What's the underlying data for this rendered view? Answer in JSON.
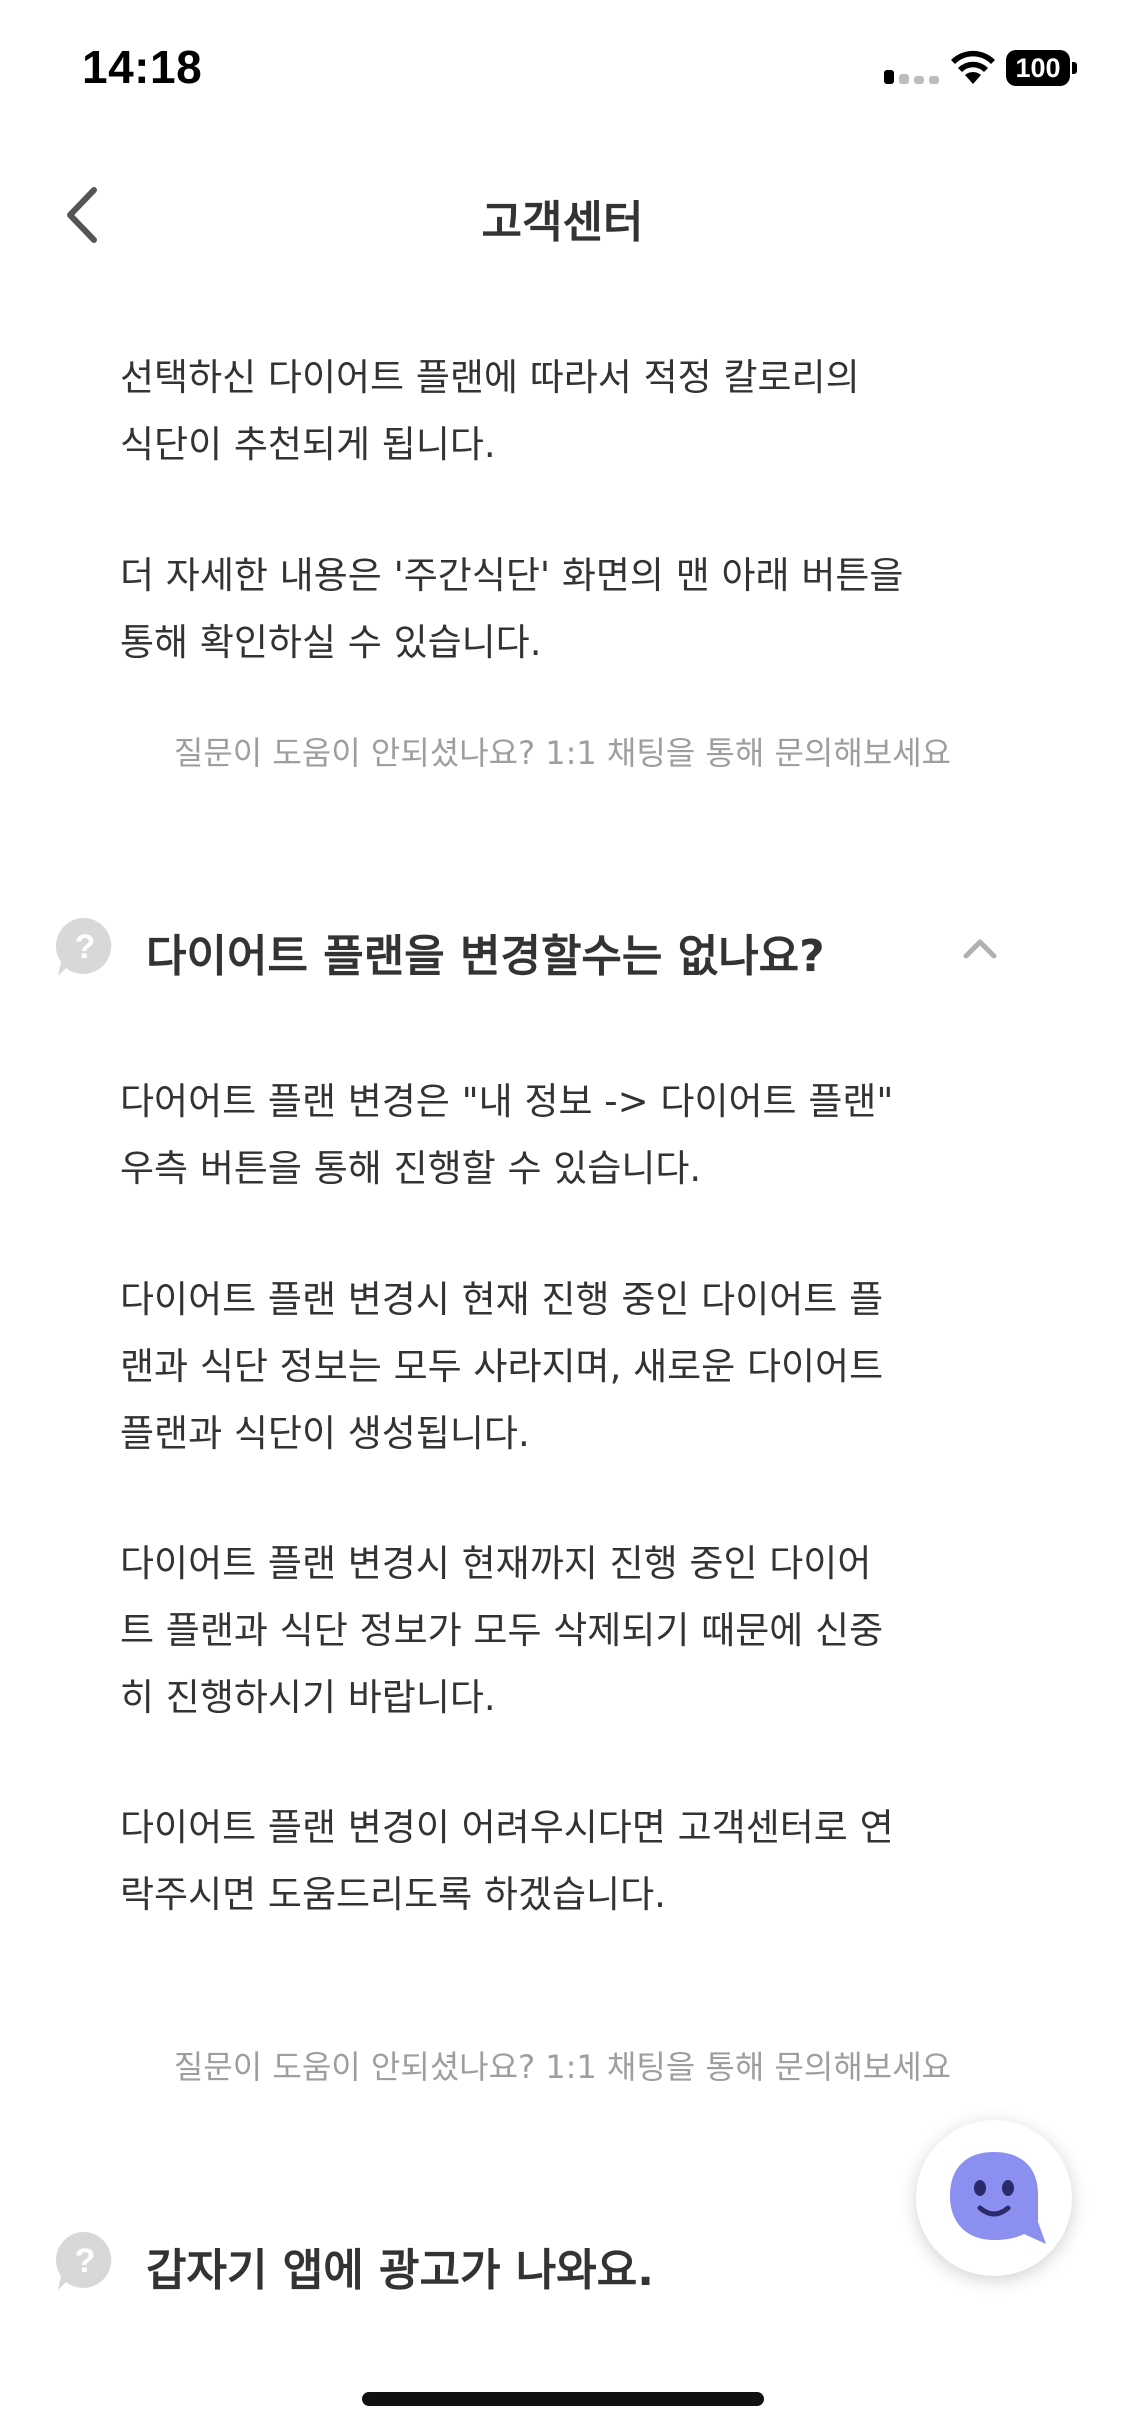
{
  "status_bar": {
    "time": "14:18",
    "battery": "100"
  },
  "nav": {
    "title": "고객센터",
    "back_icon": "chevron-left-icon"
  },
  "faq_prev": {
    "answer_p1": "선택하신 다이어트 플랜에 따라서 적정 칼로리의\n식단이 추천되게 됩니다.",
    "answer_p2": "더 자세한 내용은 '주간식단' 화면의 맨 아래 버튼을\n통해 확인하실 수 있습니다.",
    "help_link": "질문이 도움이 안되셨나요? 1:1 채팅을 통해 문의해보세요"
  },
  "faq_plan": {
    "question": "다이어트 플랜을 변경할수는 없나요?",
    "expanded": true,
    "answer_p1": "다어어트 플랜 변경은 \"내 정보 -> 다이어트 플랜\"\n우측 버튼을 통해 진행할 수 있습니다.",
    "answer_p2": "다이어트 플랜 변경시 현재 진행 중인 다이어트 플\n랜과 식단 정보는 모두 사라지며, 새로운 다이어트\n플랜과 식단이 생성됩니다.",
    "answer_p3": "다이어트 플랜 변경시 현재까지 진행 중인 다이어\n트 플랜과 식단 정보가 모두 삭제되기 때문에 신중\n히 진행하시기 바랍니다.",
    "answer_p4": "다이어트 플랜 변경이 어려우시다면 고객센터로 연\n락주시면 도움드리도록 하겠습니다.",
    "help_link": "질문이 도움이 안되셨나요? 1:1 채팅을 통해 문의해보세요"
  },
  "faq_ads": {
    "question": "갑자기 앱에 광고가 나와요."
  },
  "colors": {
    "text": "#333333",
    "muted": "#9e9e9e",
    "chat_accent": "#8b8ff0"
  }
}
